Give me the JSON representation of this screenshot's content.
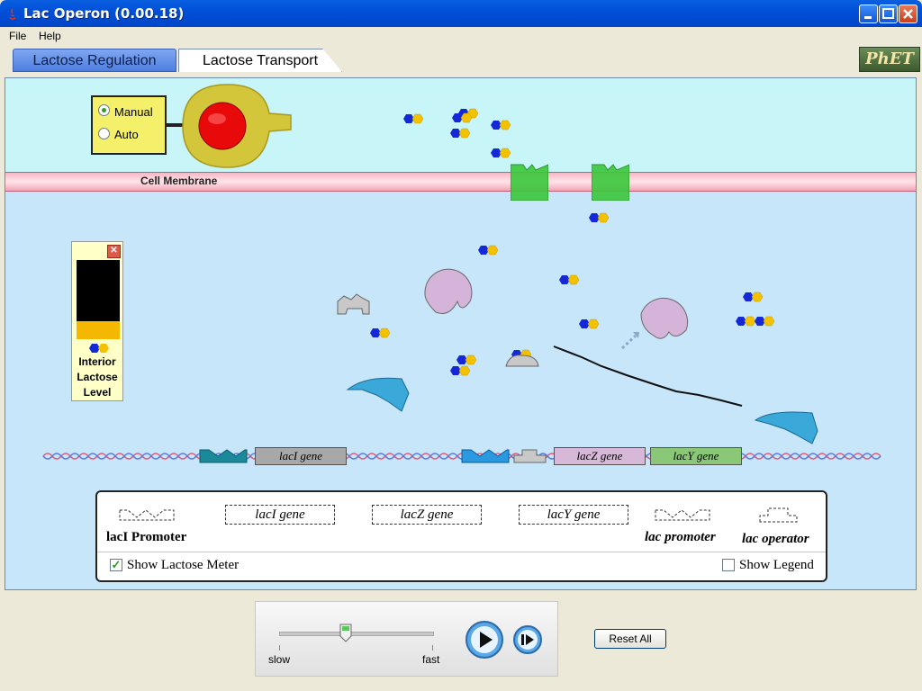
{
  "window": {
    "title": "Lac Operon (0.00.18)"
  },
  "menu": {
    "file": "File",
    "help": "Help"
  },
  "tabs": {
    "tab1": "Lactose Regulation",
    "tab2": "Lactose Transport"
  },
  "logo": "PhET",
  "cell": {
    "membrane_label": "Cell Membrane"
  },
  "mode": {
    "manual_label": "Manual",
    "auto_label": "Auto",
    "selected": "Manual"
  },
  "meter": {
    "line1": "Interior",
    "line2": "Lactose",
    "line3": "Level",
    "close": "✕"
  },
  "dna": {
    "laci_gene": "lacI gene",
    "lacz_gene": "lacZ gene",
    "lacy_gene": "lacY gene"
  },
  "legend": {
    "laci_promoter": "lacI Promoter",
    "laci_gene": "lacI gene",
    "lacz_gene": "lacZ gene",
    "lacy_gene": "lacY gene",
    "lac_promoter": "lac promoter",
    "lac_operator": "lac operator",
    "show_meter": "Show Lactose Meter",
    "show_meter_checked": true,
    "show_legend": "Show Legend",
    "show_legend_checked": false
  },
  "controls": {
    "slow": "slow",
    "fast": "fast",
    "reset": "Reset All"
  },
  "colors": {
    "glucose": "#1428D8",
    "galactose": "#F2C200",
    "transporter": "#3CC83C",
    "dna_red": "#E05A7A",
    "dna_blue": "#5A7AE0"
  }
}
